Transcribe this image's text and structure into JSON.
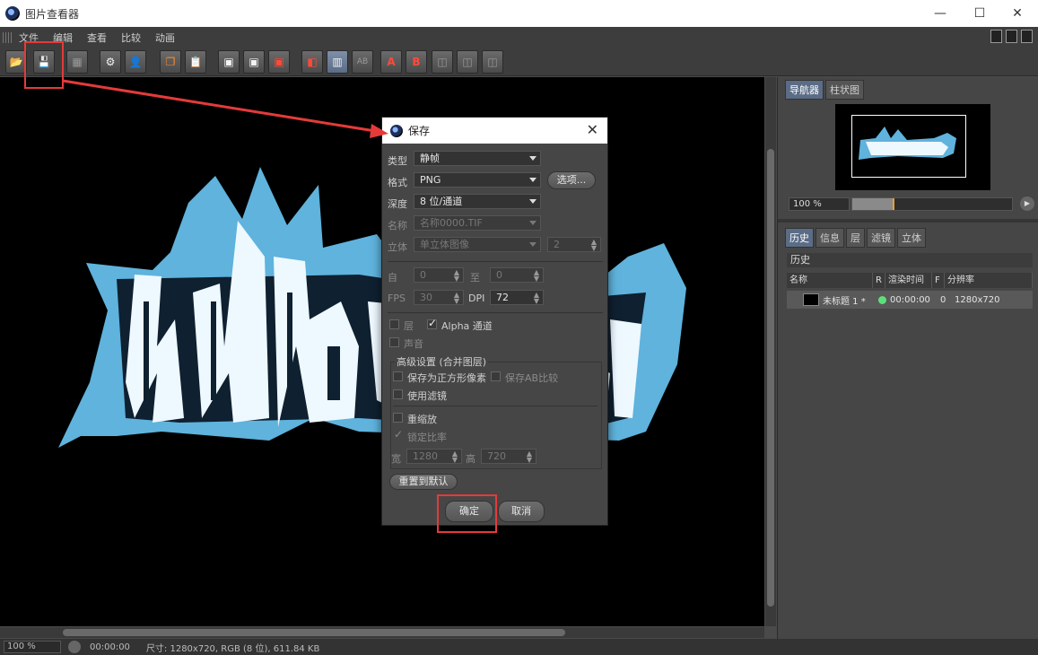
{
  "window": {
    "title": "图片查看器",
    "minimize": "—",
    "maximize": "☐",
    "close": "✕"
  },
  "menu": [
    "文件",
    "编辑",
    "查看",
    "比较",
    "动画"
  ],
  "toolbar": {
    "buttons": [
      {
        "name": "open-icon",
        "glyph": "📂"
      },
      {
        "name": "save-icon",
        "glyph": "💾"
      },
      {
        "name": "grid-icon",
        "glyph": "▦"
      },
      {
        "name": "render-queue-icon",
        "glyph": "⚙"
      },
      {
        "name": "user-icon",
        "glyph": "👤"
      },
      {
        "name": "copy-icon",
        "glyph": "❐"
      },
      {
        "name": "paste-icon",
        "glyph": "📋"
      },
      {
        "name": "view-1-icon",
        "glyph": "▣"
      },
      {
        "name": "view-2-icon",
        "glyph": "▣"
      },
      {
        "name": "view-3-icon",
        "glyph": "▣"
      },
      {
        "name": "compare-icon",
        "glyph": "◧"
      },
      {
        "name": "ab-active-icon",
        "glyph": "▥"
      },
      {
        "name": "ab-icon",
        "glyph": "AB"
      },
      {
        "name": "set-a-icon",
        "glyph": "A"
      },
      {
        "name": "set-b-icon",
        "glyph": "B"
      },
      {
        "name": "split-1-icon",
        "glyph": "◫"
      },
      {
        "name": "split-2-icon",
        "glyph": "◫"
      },
      {
        "name": "split-3-icon",
        "glyph": "◫"
      }
    ]
  },
  "status": {
    "zoom": "100 %",
    "time": "00:00:00",
    "info": "尺寸: 1280x720, RGB (8 位), 611.84 KB"
  },
  "right_panel": {
    "top_tabs": [
      "导航器",
      "柱状图"
    ],
    "nav_zoom": "100 %",
    "nav_zoom_fraction": 0.25,
    "bottom_tabs": [
      "历史",
      "信息",
      "层",
      "滤镜",
      "立体"
    ],
    "history_title": "历史",
    "columns": [
      "名称",
      "R",
      "渲染时间",
      "F",
      "分辨率"
    ],
    "rows": [
      {
        "name": "未标题 1 *",
        "time": "00:00:00",
        "frame": "0",
        "resolution": "1280x720"
      }
    ]
  },
  "dialog": {
    "title": "保存",
    "type_label": "类型",
    "type_value": "静帧",
    "format_label": "格式",
    "format_value": "PNG",
    "options_button": "选项...",
    "depth_label": "深度",
    "depth_value": "8 位/通道",
    "name_label": "名称",
    "name_value": "名称0000.TIF",
    "stereo_label": "立体",
    "stereo_value": "单立体图像",
    "stereo_num": "2",
    "from_label": "自",
    "from_value": "0",
    "to_label": "至",
    "to_value": "0",
    "fps_label": "FPS",
    "fps_value": "30",
    "dpi_label": "DPI",
    "dpi_value": "72",
    "layers_label": "层",
    "alpha_label": "Alpha 通道",
    "sound_label": "声音",
    "advanced_label": "高级设置 (合并图层)",
    "square_pixels_label": "保存为正方形像素",
    "save_ab_label": "保存AB比较",
    "use_filter_label": "使用滤镜",
    "rescale_label": "重缩放",
    "lock_ratio_label": "锁定比率",
    "width_label": "宽",
    "width_value": "1280",
    "height_label": "高",
    "height_value": "720",
    "reset_button": "重置到默认",
    "ok_button": "确定",
    "cancel_button": "取消"
  },
  "artwork": {
    "title_text": "冰临城夏",
    "outline_color": "#5fb3dd",
    "fill_color": "#eef8ff"
  },
  "annotation_color": "#e53a3a"
}
